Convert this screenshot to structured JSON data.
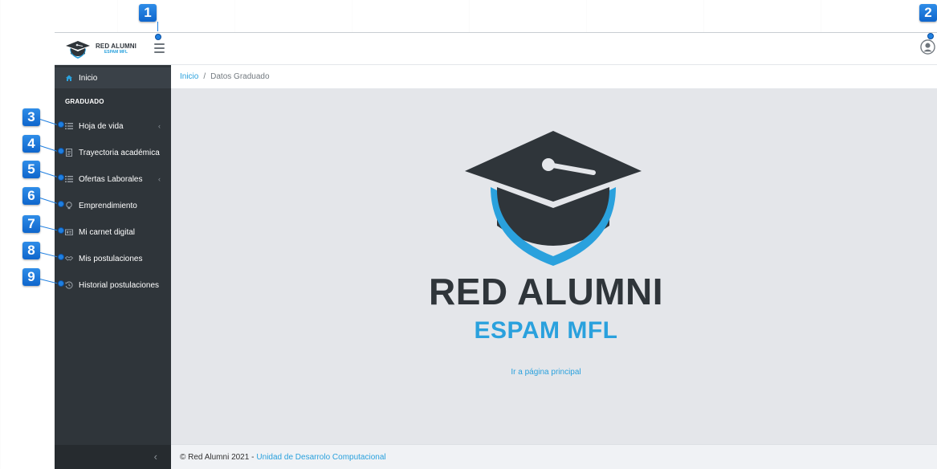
{
  "brand": {
    "name": "RED ALUMNI",
    "subname": "ESPAM MFL"
  },
  "sidebar": {
    "home_label": "Inicio",
    "section_title": "GRADUADO",
    "items": [
      {
        "label": "Hoja de vida",
        "icon": "list-icon",
        "has_caret": true
      },
      {
        "label": "Trayectoria académica",
        "icon": "document-icon",
        "has_caret": false
      },
      {
        "label": "Ofertas Laborales",
        "icon": "list-icon",
        "has_caret": true
      },
      {
        "label": "Emprendimiento",
        "icon": "lightbulb-icon",
        "has_caret": false
      },
      {
        "label": "Mi carnet digital",
        "icon": "id-card-icon",
        "has_caret": false
      },
      {
        "label": "Mis postulaciones",
        "icon": "handshake-icon",
        "has_caret": false
      },
      {
        "label": "Historial postulaciones",
        "icon": "history-icon",
        "has_caret": false
      }
    ],
    "caret": "‹",
    "collapse": "‹"
  },
  "breadcrumb": {
    "home": "Inicio",
    "separator": "/",
    "current": "Datos Graduado"
  },
  "main": {
    "title": "RED ALUMNI",
    "subtitle": "ESPAM MFL",
    "link_label": "Ir a página principal"
  },
  "footer": {
    "copyright": "© Red Alumni 2021 -",
    "link_label": "Unidad de Desarrolo Computacional"
  },
  "markers": [
    "1",
    "2",
    "3",
    "4",
    "5",
    "6",
    "7",
    "8",
    "9"
  ],
  "colors": {
    "sidebar_bg": "#2f353a",
    "accent": "#2aa1dd",
    "marker": "#1f7fe0",
    "main_bg": "#e4e6ea"
  }
}
